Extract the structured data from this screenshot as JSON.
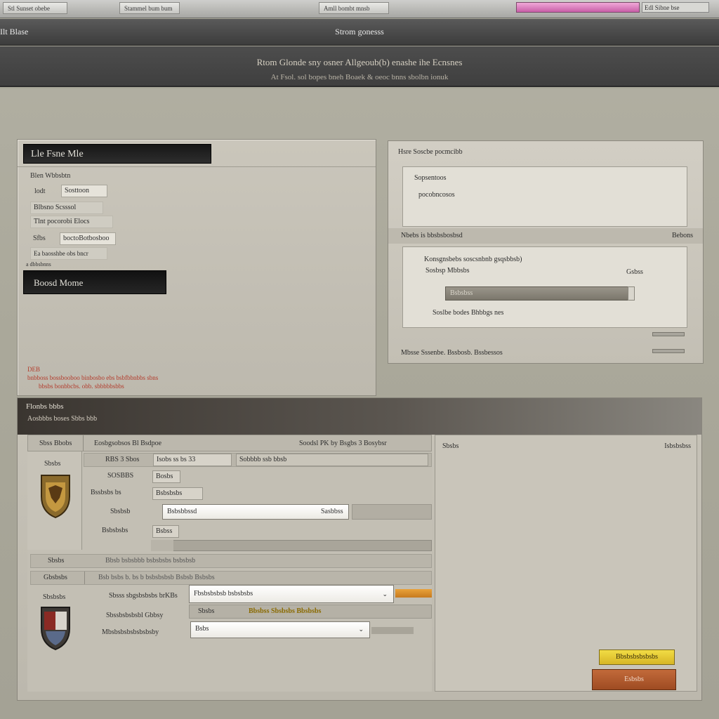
{
  "browser": {
    "tab1": "Stl Sunset obebe",
    "tab2": "Stammel bum bum",
    "tab3": "Amll bombt mnsb",
    "right_field": "Edl Sibne bse"
  },
  "window": {
    "title_left": "Ilt Blase",
    "title_center": "Strom gonesss"
  },
  "hero": {
    "line1": "Rtom Glonde sny osner Allgeoub(b) enashe ihe Ecnsnes",
    "line2": "At Fsol. sol bopes bneh Boaek & oeoc bnns sbolbn ionuk"
  },
  "left_panel": {
    "header": "Lle Fsne Mle",
    "label_top": "Blen Wbbsbtn",
    "rows": [
      {
        "label": "lodt",
        "value": "Sosttoon"
      },
      {
        "label": "Blbsno Scsssol",
        "value": ""
      },
      {
        "label": "Tlnt pocorobi Elocs",
        "value": ""
      },
      {
        "label": "Sfbs",
        "value": "boctoBotbosboo"
      },
      {
        "label": "Ea baosshbe obs bncr",
        "value": ""
      }
    ],
    "small_label": "a dbbsbnns",
    "action_button": "Boosd Mome",
    "red_line1": "DEB",
    "red_line2": "bnbboss    bossbooboo binbosbo ebs  bsbfbbnbbs sbns",
    "red_line3": "bbsbs bonbbcbs. obb. sbbbbbsbbs"
  },
  "right_panel": {
    "title": "Hsre Soscbe pocmcibb",
    "box1_label": "Sopsentoos",
    "box1_sub": "pocobncosos",
    "section_label": "Nbebs is bbsbsbosbsd",
    "section_right": "Bebons",
    "box2_line1": "Konsgnsbebs soscsnbnb gsqsbbsb)",
    "box2_line2": "Sosbsp Mbbsbs",
    "box2_right": "Gsbss",
    "slider_label": "Bsbsbss",
    "box2_line3": "Soslbe bodes Bhbbgs nes",
    "footer": "Mbsse Sssenbe. Bssbosb. Bssbessos"
  },
  "bottom_panel": {
    "header1": "Flonbs bbbs",
    "header2": "Aosbbbs boses Sbbs bbb",
    "col1": "Sbss Bbobs",
    "col2": "Eosbgsobsos Bl Bsdpoe",
    "col3": "Soodsl PK by Bsgbs 3 Bosybsr",
    "crest_label": "Sbsbs",
    "rows": [
      {
        "label": "RBS 3 Sbos",
        "value": "Isobs ss bs 33",
        "extra": "Sobbbb ssb bbsb"
      },
      {
        "label": "SOSBBS",
        "value": "Bosbs"
      },
      {
        "label": "Bssbsbs bs",
        "value": "Bsbsbsbs"
      },
      {
        "label": "Sbsbsb",
        "value": "Bsbsbbssd",
        "right": "Sasbbss"
      },
      {
        "label": "Bsbsbsbs",
        "value": "Bsbss"
      }
    ],
    "wide_row1_label": "Sbsbs",
    "wide_row1_value": "Bbsb bsbsbbb bsbsbsbs bsbsbsb",
    "wide_row2_label": "Gbsbsbs",
    "wide_row2_value": "Bsb bsbs b. bs b bsbsbsbsb Bsbsb Bsbsbs",
    "crest2_label": "Sbsbsbs",
    "lower": [
      {
        "label": "Sbsss sbgsbsbsbs brKBs",
        "value": "Fbsbsbsbsb bsbsbsbs"
      },
      {
        "label": "Sbssbsbsbsbl Gbbsy",
        "value": "Sbsbs",
        "highlight": "Bbsbss Sbsbsbs Bbsbsbs"
      },
      {
        "label": "Mbsbsbsbsbsbsbsby",
        "value": "Bsbs"
      }
    ],
    "right_title": "Sbsbs",
    "right_corner": "Isbsbsbss",
    "yellow_button": "Bbsbsbsbsbsbs",
    "orange_button": "Esbsbs"
  },
  "colors": {
    "accent_yellow": "#e8cc36",
    "accent_orange": "#b25a2d",
    "header_dark": "#1a1a1a",
    "pink_bar": "#d877b8"
  }
}
